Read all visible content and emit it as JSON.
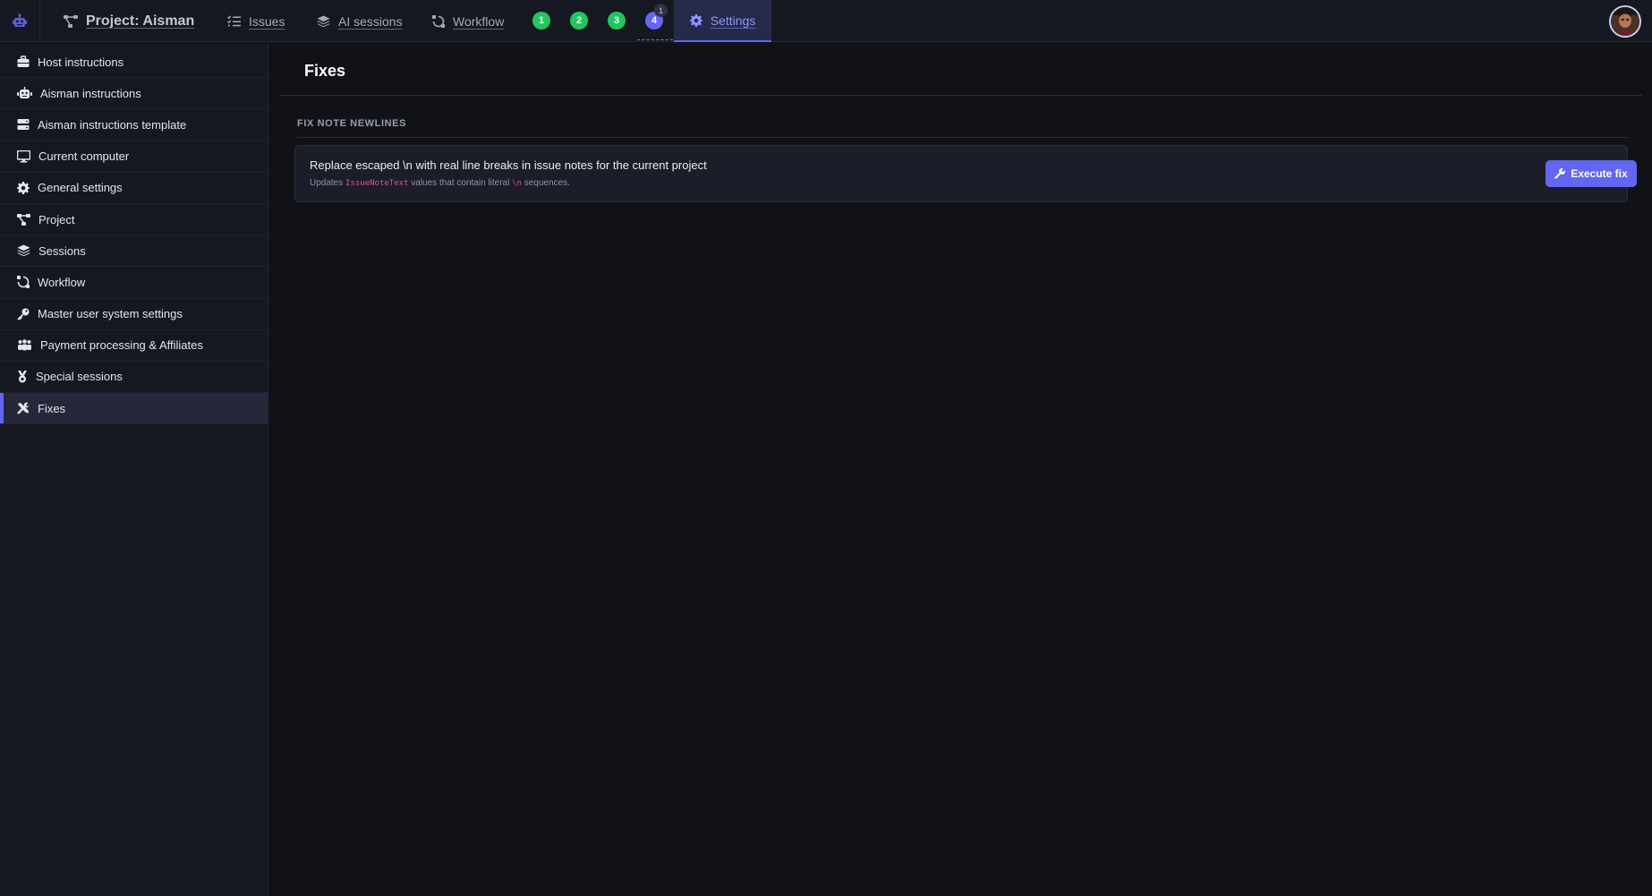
{
  "topbar": {
    "project_label": "Project: Aisman",
    "nav": {
      "issues": "Issues",
      "ai_sessions": "AI sessions",
      "workflow": "Workflow",
      "settings": "Settings"
    },
    "badges": [
      "1",
      "2",
      "3",
      "4"
    ],
    "badge_count": "1"
  },
  "sidebar": {
    "items": [
      {
        "label": "Host instructions",
        "icon": "briefcase-icon"
      },
      {
        "label": "Aisman instructions",
        "icon": "robot-icon"
      },
      {
        "label": "Aisman instructions template",
        "icon": "server-icon"
      },
      {
        "label": "Current computer",
        "icon": "desktop-icon"
      },
      {
        "label": "General settings",
        "icon": "gear-icon"
      },
      {
        "label": "Project",
        "icon": "project-diagram-icon"
      },
      {
        "label": "Sessions",
        "icon": "layers-icon"
      },
      {
        "label": "Workflow",
        "icon": "workflow-icon"
      },
      {
        "label": "Master user system settings",
        "icon": "key-icon"
      },
      {
        "label": "Payment processing & Affiliates",
        "icon": "users-icon"
      },
      {
        "label": "Special sessions",
        "icon": "medal-icon"
      },
      {
        "label": "Fixes",
        "icon": "tools-icon"
      }
    ],
    "active_index": 11
  },
  "main": {
    "title": "Fixes",
    "section_label": "FIX NOTE NEWLINES",
    "fix": {
      "title": "Replace escaped \\n with real line breaks in issue notes for the current project",
      "desc_prefix": "Updates ",
      "desc_code": "IssueNoteText",
      "desc_middle": " values that contain literal ",
      "desc_code2": "\\n",
      "desc_suffix": " sequences.",
      "button_label": "Execute fix"
    }
  },
  "colors": {
    "accent": "#6366f1",
    "success": "#22c55e",
    "code": "#ec4899",
    "background": "#111218",
    "panel": "#161821"
  }
}
